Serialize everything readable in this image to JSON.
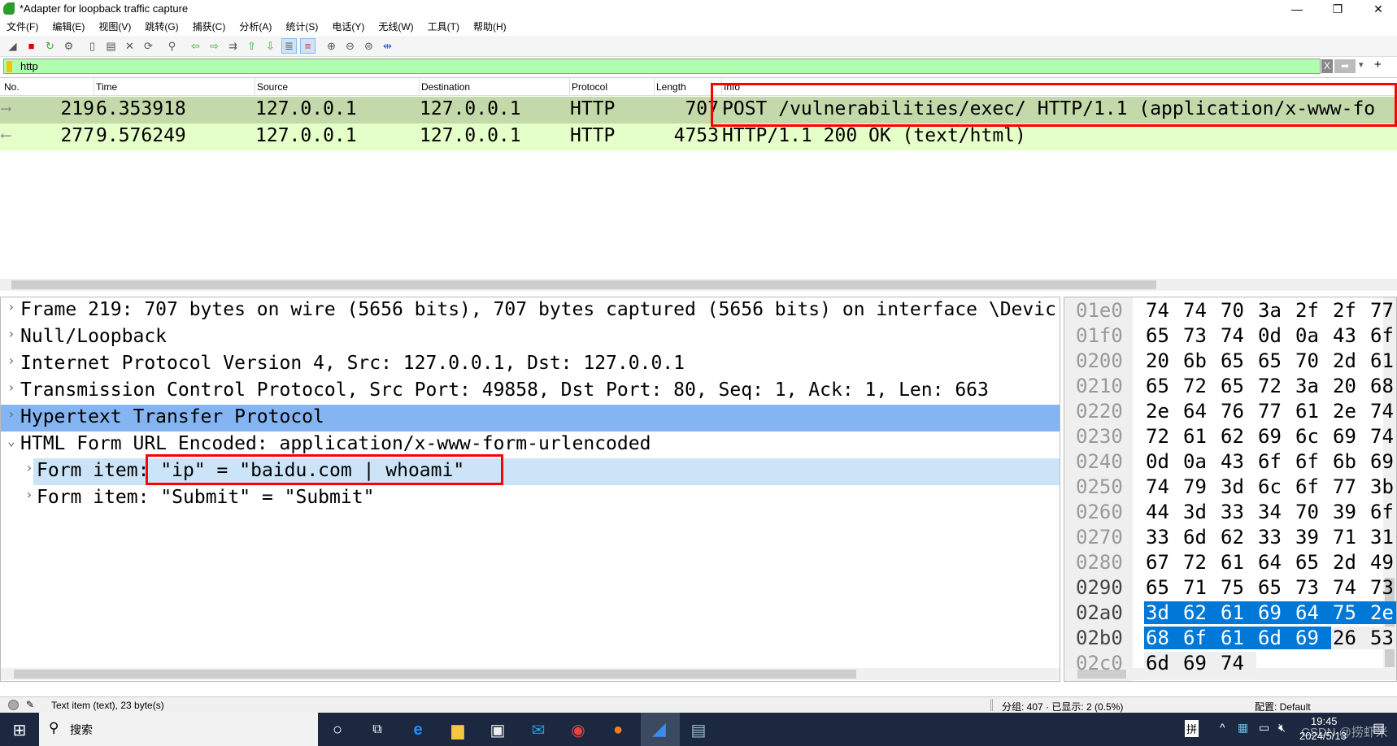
{
  "window": {
    "title": "*Adapter for loopback traffic capture",
    "minimize": "—",
    "restore": "❐",
    "close": "✕"
  },
  "menu": [
    "文件(F)",
    "编辑(E)",
    "视图(V)",
    "跳转(G)",
    "捕获(C)",
    "分析(A)",
    "统计(S)",
    "电话(Y)",
    "无线(W)",
    "工具(T)",
    "帮助(H)"
  ],
  "toolbar": [
    "shark-fin-icon",
    "stop-icon",
    "restart-icon",
    "options-icon",
    "open-icon",
    "save-icon",
    "close-file-icon",
    "reload-icon",
    "find-icon",
    "back-icon",
    "forward-icon",
    "goto-icon",
    "first-icon",
    "last-icon",
    "autoscroll-icon",
    "colorize-icon",
    "zoom-in-icon",
    "zoom-out-icon",
    "zoom-reset-icon",
    "resize-columns-icon"
  ],
  "filter": {
    "value": "http",
    "clear": "X",
    "apply": "➡",
    "dropdown": "▾",
    "add": "+"
  },
  "packet_list": {
    "columns": [
      "No.",
      "Time",
      "Source",
      "Destination",
      "Protocol",
      "Length",
      "Info"
    ],
    "rows": [
      {
        "no": "219",
        "time": "6.353918",
        "source": "127.0.0.1",
        "destination": "127.0.0.1",
        "protocol": "HTTP",
        "length": "707",
        "info": "POST /vulnerabilities/exec/ HTTP/1.1  (application/x-www-fo"
      },
      {
        "no": "277",
        "time": "9.576249",
        "source": "127.0.0.1",
        "destination": "127.0.0.1",
        "protocol": "HTTP",
        "length": "4753",
        "info": "HTTP/1.1 200 OK  (text/html)"
      }
    ],
    "selected_row": 0
  },
  "details": [
    {
      "text": "Frame 219: 707 bytes on wire (5656 bits), 707 bytes captured (5656 bits) on interface \\Devic",
      "arrow": "›"
    },
    {
      "text": "Null/Loopback",
      "arrow": "›"
    },
    {
      "text": "Internet Protocol Version 4, Src: 127.0.0.1, Dst: 127.0.0.1",
      "arrow": "›"
    },
    {
      "text": "Transmission Control Protocol, Src Port: 49858, Dst Port: 80, Seq: 1, Ack: 1, Len: 663",
      "arrow": "›"
    },
    {
      "text": "Hypertext Transfer Protocol",
      "arrow": "›"
    },
    {
      "text": "HTML Form URL Encoded: application/x-www-form-urlencoded",
      "arrow": "⌄"
    },
    {
      "text": "Form item: \"ip\" = \"baidu.com | whoami\"",
      "arrow": "›"
    },
    {
      "text": "Form item: \"Submit\" = \"Submit\"",
      "arrow": "›"
    }
  ],
  "bytes": [
    {
      "off": "01e0",
      "b": [
        "74",
        "74",
        "70",
        "3a",
        "2f",
        "2f",
        "77"
      ]
    },
    {
      "off": "01f0",
      "b": [
        "65",
        "73",
        "74",
        "0d",
        "0a",
        "43",
        "6f"
      ]
    },
    {
      "off": "0200",
      "b": [
        "20",
        "6b",
        "65",
        "65",
        "70",
        "2d",
        "61"
      ]
    },
    {
      "off": "0210",
      "b": [
        "65",
        "72",
        "65",
        "72",
        "3a",
        "20",
        "68"
      ]
    },
    {
      "off": "0220",
      "b": [
        "2e",
        "64",
        "76",
        "77",
        "61",
        "2e",
        "74"
      ]
    },
    {
      "off": "0230",
      "b": [
        "72",
        "61",
        "62",
        "69",
        "6c",
        "69",
        "74"
      ]
    },
    {
      "off": "0240",
      "b": [
        "0d",
        "0a",
        "43",
        "6f",
        "6f",
        "6b",
        "69"
      ]
    },
    {
      "off": "0250",
      "b": [
        "74",
        "79",
        "3d",
        "6c",
        "6f",
        "77",
        "3b"
      ]
    },
    {
      "off": "0260",
      "b": [
        "44",
        "3d",
        "33",
        "34",
        "70",
        "39",
        "6f"
      ]
    },
    {
      "off": "0270",
      "b": [
        "33",
        "6d",
        "62",
        "33",
        "39",
        "71",
        "31"
      ]
    },
    {
      "off": "0280",
      "b": [
        "67",
        "72",
        "61",
        "64",
        "65",
        "2d",
        "49"
      ]
    },
    {
      "off": "0290",
      "b": [
        "65",
        "71",
        "75",
        "65",
        "73",
        "74",
        "73"
      ]
    },
    {
      "off": "02a0",
      "b": [
        "3d",
        "62",
        "61",
        "69",
        "64",
        "75",
        "2e"
      ]
    },
    {
      "off": "02b0",
      "b": [
        "68",
        "6f",
        "61",
        "6d",
        "69",
        "26",
        "53"
      ]
    },
    {
      "off": "02c0",
      "b": [
        "6d",
        "69",
        "74"
      ]
    }
  ],
  "status": {
    "left": "Text item (text), 23 byte(s)",
    "packets": "分组: 407 · 已显示: 2 (0.5%)",
    "profile": "配置: Default"
  },
  "taskbar": {
    "search": "搜索",
    "ime": "拼",
    "time": "19:45",
    "date": "2024/5/13",
    "watermark": "CSDN @捞虾米"
  },
  "colors": {
    "selected_row": "#c3d9a9",
    "http_row": "#e4ffc7",
    "filter_ok": "#afffaf",
    "detail_selected": "#85b4f2",
    "detail_related": "#cce4f7",
    "bytes_selected": "#0078d7",
    "highlight_box": "#ff0000"
  }
}
